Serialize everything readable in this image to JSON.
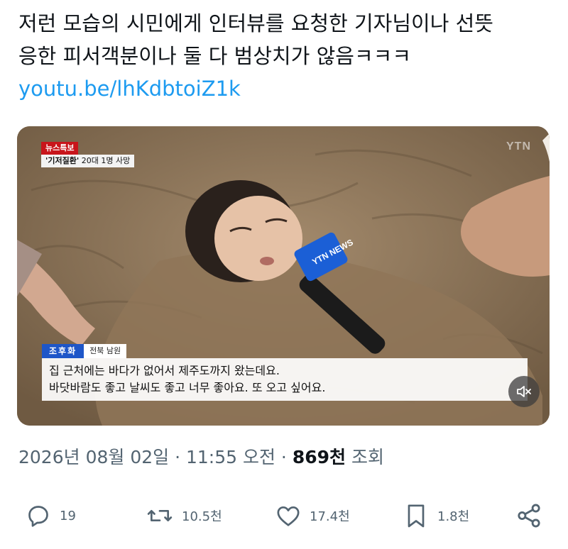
{
  "tweet": {
    "text_line1": "저런 모습의 시민에게 인터뷰를 요청한 기자님이나 선뜻",
    "text_line2": "응한 피서객분이나 둘 다 범상치가 않음ㅋㅋㅋ",
    "link": "youtu.be/lhKdbtoiZ1k"
  },
  "video": {
    "badge_news": "뉴스특보",
    "badge_topic_quoted": "'기저질환'",
    "badge_topic_rest": " 20대 1명 사망",
    "broadcaster_logo": "YTN",
    "mic_label": "YTN NEWS",
    "speaker_name": "조후화",
    "speaker_region": "전북 남원",
    "caption_line1": "집 근처에는 바다가 없어서 제주도까지 왔는데요.",
    "caption_line2": "바닷바람도 좋고 날씨도 좋고 너무 좋아요. 또 오고 싶어요.",
    "muted": true
  },
  "meta": {
    "datetime": "2026년 08월 02일 · 11:55 오전 · ",
    "views_count": "869천",
    "views_label": " 조회"
  },
  "actions": {
    "reply_count": "19",
    "retweet_count": "10.5천",
    "like_count": "17.4천",
    "bookmark_count": "1.8천"
  },
  "colors": {
    "link": "#1d9bf0",
    "secondary_text": "#536471",
    "news_badge": "#c8151b",
    "speaker_badge": "#1e56c8"
  }
}
